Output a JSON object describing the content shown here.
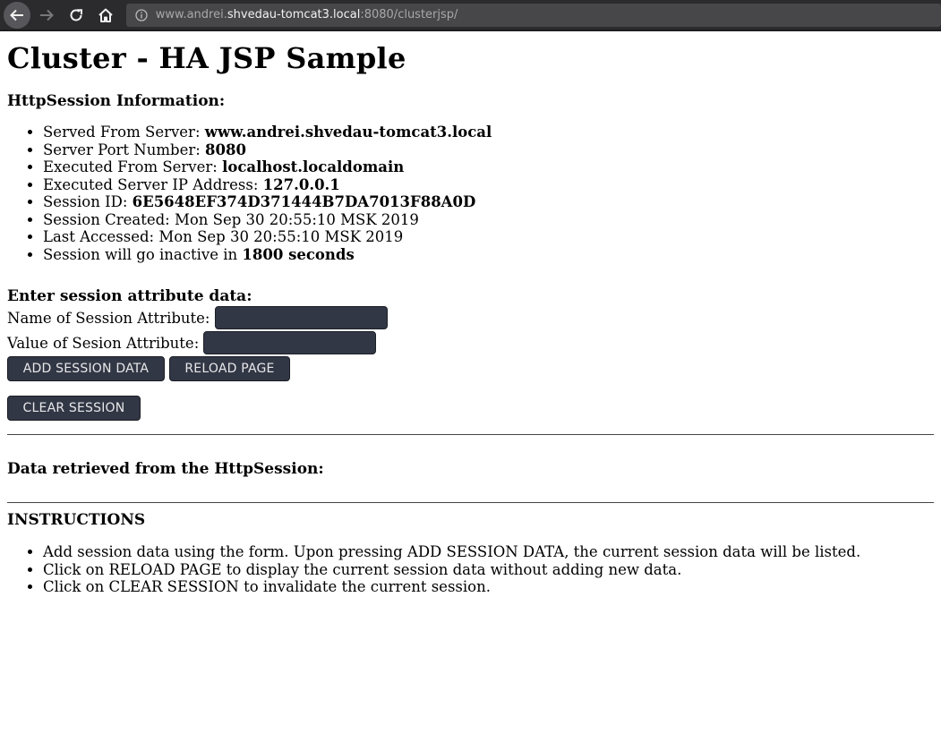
{
  "browser": {
    "url_prefix": "www.andrei.",
    "url_host": "shvedau-tomcat3.local",
    "url_suffix": ":8080/clusterjsp/"
  },
  "page": {
    "title": "Cluster - HA JSP Sample",
    "session_info_heading": "HttpSession Information:",
    "info": [
      {
        "label": "Served From Server: ",
        "value": "www.andrei.shvedau-tomcat3.local"
      },
      {
        "label": "Server Port Number: ",
        "value": "8080"
      },
      {
        "label": "Executed From Server: ",
        "value": "localhost.localdomain"
      },
      {
        "label": "Executed Server IP Address: ",
        "value": "127.0.0.1"
      },
      {
        "label": "Session ID: ",
        "value": "6E5648EF374D371444B7DA7013F88A0D"
      },
      {
        "label": "Session Created: Mon Sep 30 20:55:10 MSK 2019",
        "value": ""
      },
      {
        "label": "Last Accessed: Mon Sep 30 20:55:10 MSK 2019",
        "value": ""
      },
      {
        "label": "Session will go inactive in ",
        "value": "1800 seconds"
      }
    ],
    "form": {
      "heading": "Enter session attribute data:",
      "name_label": "Name of Session Attribute:",
      "value_label": "Value of Sesion Attribute:",
      "add_button": "ADD SESSION DATA",
      "reload_button": "RELOAD PAGE",
      "clear_button": "CLEAR SESSION"
    },
    "data_heading": "Data retrieved from the HttpSession:",
    "instructions_heading": "INSTRUCTIONS",
    "instructions": [
      "Add session data using the form. Upon pressing ADD SESSION DATA, the current session data will be listed.",
      "Click on RELOAD PAGE to display the current session data without adding new data.",
      "Click on CLEAR SESSION to invalidate the current session."
    ]
  }
}
